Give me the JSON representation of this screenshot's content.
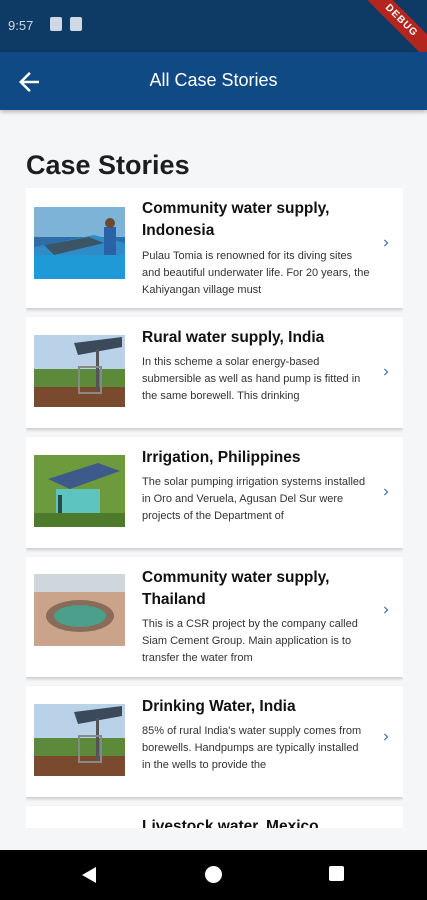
{
  "status": {
    "time": "9:57",
    "debug": "DEBUG"
  },
  "app_bar": {
    "title": "All Case Stories"
  },
  "page": {
    "title": "Case Stories"
  },
  "stories": [
    {
      "title": "Community water supply, Indonesia",
      "description": "Pulau Tomia is renowned for its diving sites and beautiful underwater life. For 20 years, the Kahiyangan village must"
    },
    {
      "title": "Rural water supply, India",
      "description": "In this scheme a solar energy-based submersible as well as hand pump is fitted in the same borewell. This drinking"
    },
    {
      "title": "Irrigation, Philippines",
      "description": "The solar pumping irrigation systems installed in Oro and Veruela, Agusan Del Sur were projects of the Department of"
    },
    {
      "title": "Community water supply, Thailand",
      "description": "This is a CSR project by the company called Siam Cement Group. Main application is to transfer the water from"
    },
    {
      "title": "Drinking Water, India",
      "description": "85% of rural India's water supply comes from borewells. Handpumps are typically installed in the wells to provide the"
    },
    {
      "title": "Livestock water, Mexico",
      "description": ""
    }
  ]
}
